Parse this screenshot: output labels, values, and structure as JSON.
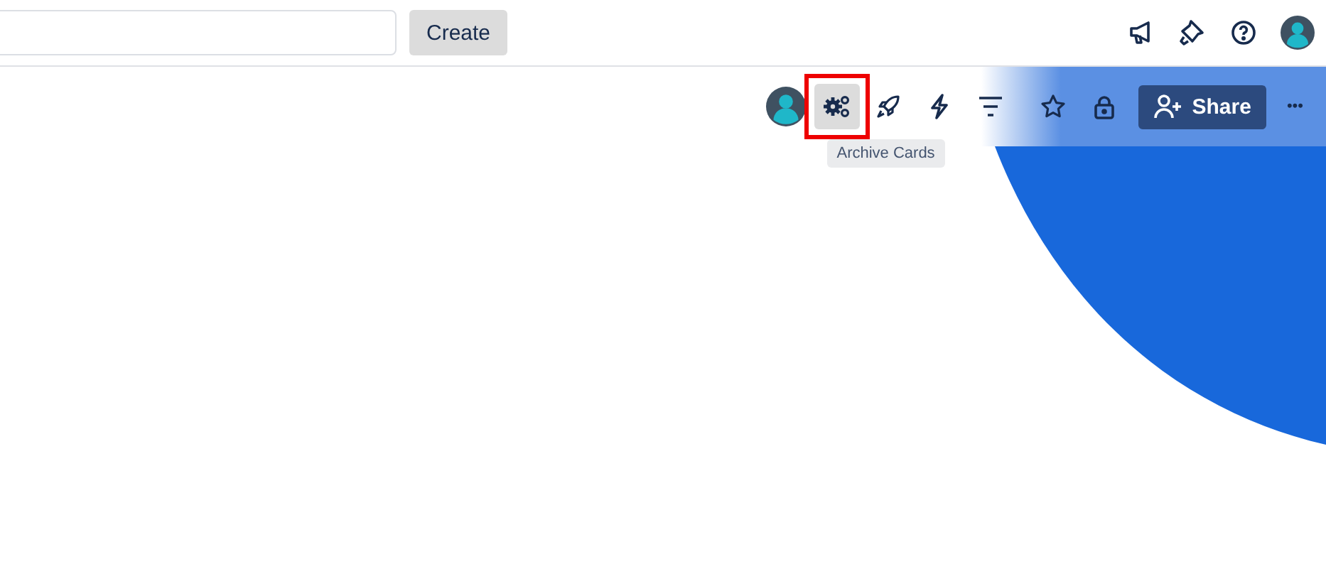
{
  "top_bar": {
    "create_button": "Create"
  },
  "board_header": {
    "tooltip": "Archive Cards",
    "highlighted_tool": true,
    "share_button": "Share",
    "more_button": "•••"
  }
}
